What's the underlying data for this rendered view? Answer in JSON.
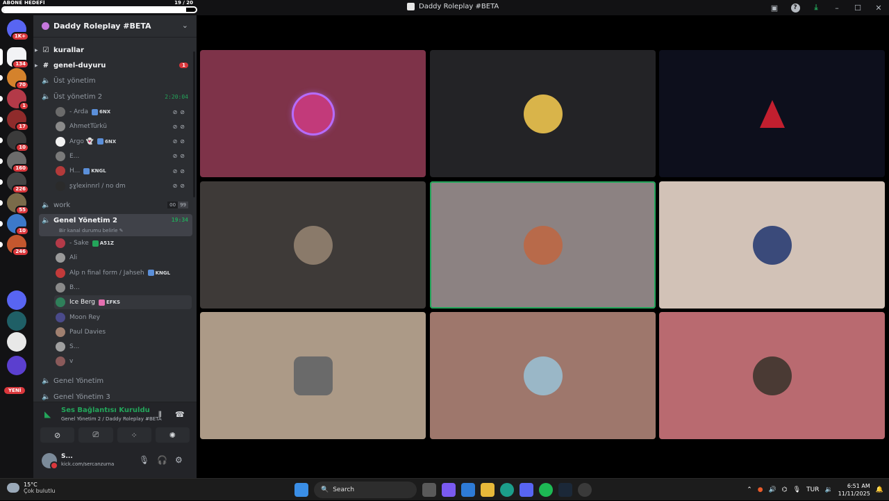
{
  "subscriber_goal": {
    "label": "ABONE HEDEFİ",
    "count": "19 / 20",
    "progress": 0.95
  },
  "window": {
    "title": "Daddy Roleplay #BETA"
  },
  "servers": [
    {
      "badge": "1K+",
      "color": "#5865f2"
    },
    {
      "badge": "134",
      "color": "#f2f3f5"
    },
    {
      "badge": "70",
      "color": "#d4822c"
    },
    {
      "badge": "1",
      "color": "#b33a48"
    },
    {
      "badge": "17",
      "color": "#8f2b2b"
    },
    {
      "badge": "10",
      "color": "#3b3b3b"
    },
    {
      "badge": "160",
      "color": "#6b6b6b"
    },
    {
      "badge": "226",
      "color": "#454545"
    },
    {
      "badge": "55",
      "color": "#7a6b4a"
    },
    {
      "badge": "10",
      "color": "#3c79c9"
    },
    {
      "badge": "246",
      "color": "#c4572e"
    },
    {
      "badge": "",
      "color": "#5865f2"
    },
    {
      "badge": "",
      "color": "#1f5f66"
    },
    {
      "badge": "",
      "color": "#e8e8e8"
    },
    {
      "badge": "",
      "color": "#5b3fcf"
    }
  ],
  "new_label": "YENİ",
  "guild": {
    "name": "Daddy Roleplay #BETA"
  },
  "channels": {
    "kurallar": "kurallar",
    "genel_duyuru": "genel-duyuru",
    "genel_duyuru_unread": "1",
    "ust_yonetim": "Üst yönetim",
    "ust_yonetim_2": "Üst yönetim 2",
    "ust_yonetim_2_timer": "2:20:04",
    "work": "work",
    "work_count": [
      "00",
      "99"
    ],
    "genel_yonetim_2": "Genel Yönetim 2",
    "genel_yonetim_2_timer": "19:34",
    "genel_yonetim_2_status": "Bir kanal durumu belirle",
    "genel_yonetim": "Genel Yönetim",
    "genel_yonetim_3": "Genel Yönetim 3"
  },
  "members_ust_yonetim_2": [
    {
      "name": "- Arda",
      "tag": "6NX",
      "color": "#6b6b6b"
    },
    {
      "name": "AhmetTürkü",
      "tag": "",
      "color": "#8a8a8a"
    },
    {
      "name": "Argo 👻",
      "tag": "6NX",
      "color": "#f2f2f2"
    },
    {
      "name": "E...",
      "tag": "",
      "color": "#7a7a7a"
    },
    {
      "name": "H...",
      "tag": "KNGL",
      "color": "#b33a3a"
    },
    {
      "name": "ʂɣlexinnrl / no dm",
      "tag": "",
      "color": "#2b2b2b"
    }
  ],
  "members_genel_yonetim_2": [
    {
      "name": "- Sake",
      "tag": "A51Z",
      "color": "#b33a48"
    },
    {
      "name": "Ali",
      "tag": "",
      "color": "#9a9a9a"
    },
    {
      "name": "Alp n final form / Jahseh",
      "tag": "KNGL",
      "color": "#c23a3a"
    },
    {
      "name": "B...",
      "tag": "",
      "color": "#8a8a8a"
    },
    {
      "name": "Ice Berg",
      "tag": "EFKS",
      "color": "#2f7f5a"
    },
    {
      "name": "Moon Rey",
      "tag": "",
      "color": "#4a4a8a"
    },
    {
      "name": "Paul Davies",
      "tag": "",
      "color": "#a08070"
    },
    {
      "name": "S...",
      "tag": "",
      "color": "#a0a0a0"
    },
    {
      "name": "v",
      "tag": "",
      "color": "#8a5a5a"
    }
  ],
  "voice_panel": {
    "status": "Ses Bağlantısı Kuruldu",
    "location": "Genel Yönetim 2 / Daddy Roleplay #BETA"
  },
  "user_panel": {
    "name": "S...",
    "status": "kick.com/sercanzurna"
  },
  "tiles": [
    {
      "bg": "#7e3349",
      "avatar": "#c23a7a",
      "ring": "#b56cff"
    },
    {
      "bg": "#232326",
      "avatar": "#d9b44a",
      "ring": ""
    },
    {
      "bg": "#0d0f1c",
      "avatar": "#c21f2f",
      "ring": ""
    },
    {
      "bg": "#3e3a38",
      "avatar": "#8a7a6a",
      "ring": ""
    },
    {
      "bg": "#8c8282",
      "avatar": "#b86a4a",
      "ring": ""
    },
    {
      "bg": "#d2c2b7",
      "avatar": "#3a4a7a",
      "ring": ""
    },
    {
      "bg": "#ac9a87",
      "avatar": "#6a6a6a",
      "ring": ""
    },
    {
      "bg": "#9e776c",
      "avatar": "#9ab7c7",
      "ring": ""
    },
    {
      "bg": "#b96a70",
      "avatar": "#4a3a34",
      "ring": ""
    }
  ],
  "taskbar": {
    "temperature": "15°C",
    "condition": "Çok bulutlu",
    "search_placeholder": "Search",
    "lang": "TUR",
    "time": "6:51 AM",
    "date": "11/11/2025"
  }
}
